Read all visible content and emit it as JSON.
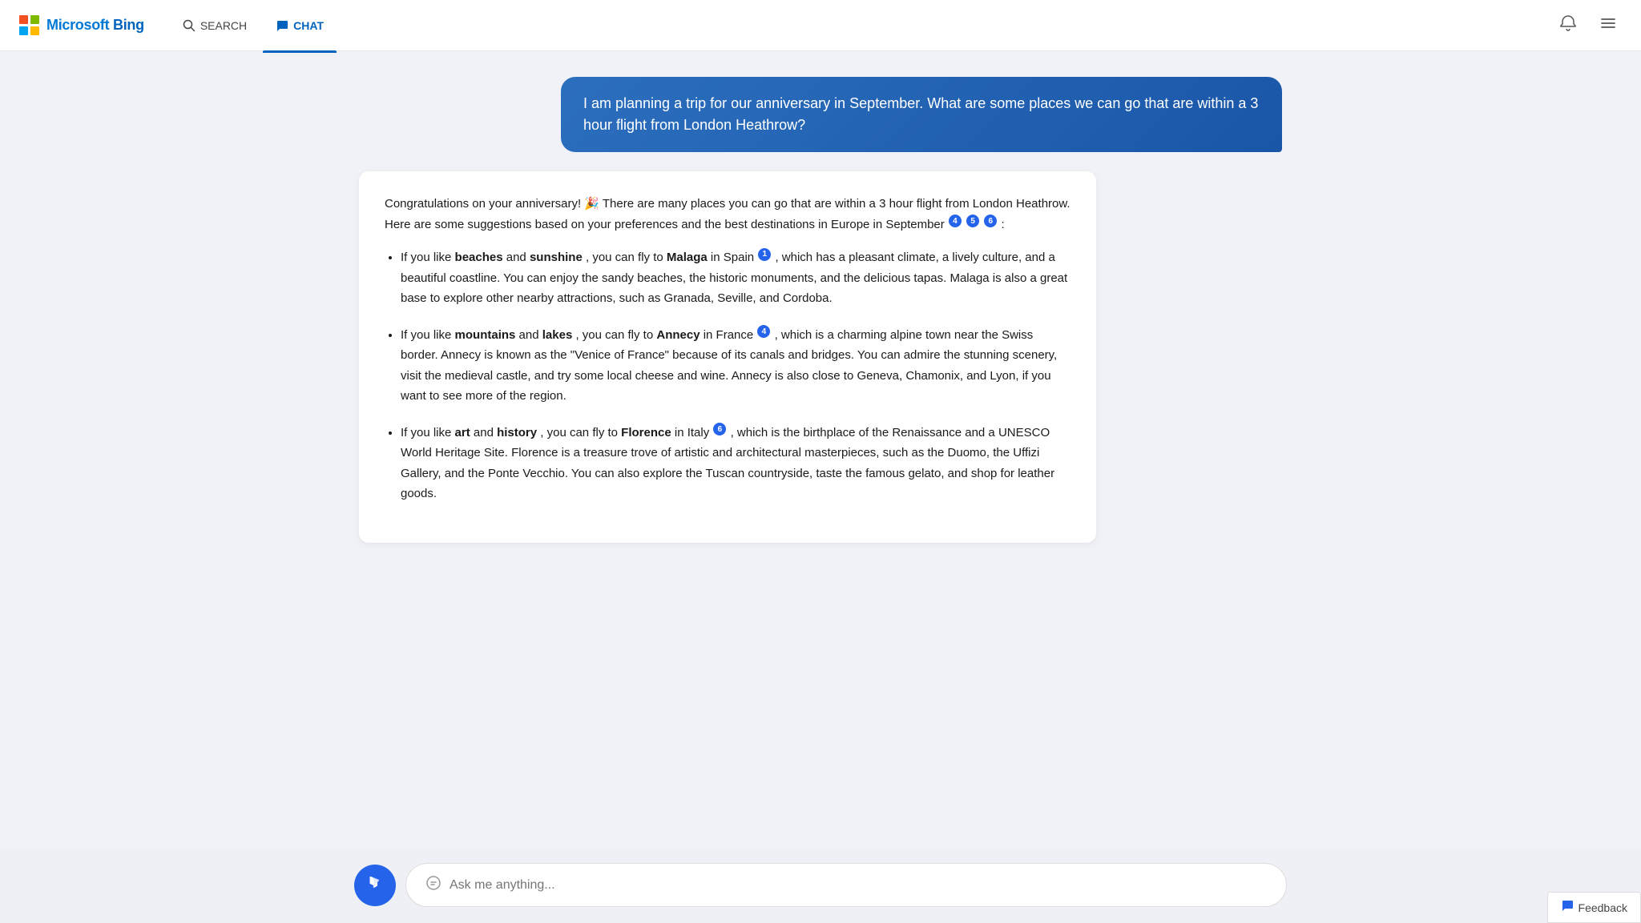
{
  "header": {
    "logo_text_part1": "Microsoft ",
    "logo_text_part2": "Bing",
    "nav": [
      {
        "id": "search",
        "label": "SEARCH",
        "icon": "🔍",
        "active": false
      },
      {
        "id": "chat",
        "label": "CHAT",
        "icon": "💬",
        "active": true
      }
    ]
  },
  "user_message": {
    "text": "I am planning a trip for our anniversary in September. What are some places we can go that are within a 3 hour flight from London Heathrow?"
  },
  "ai_response": {
    "intro": "Congratulations on your anniversary! 🎉 There are many places you can go that are within a 3 hour flight from London Heathrow. Here are some suggestions based on your preferences and the best destinations in Europe in September",
    "intro_cites": [
      "4",
      "5",
      "6"
    ],
    "items": [
      {
        "prefix": "If you like ",
        "bold1": "beaches",
        "mid1": " and ",
        "bold2": "sunshine",
        "mid2": ", you can fly to ",
        "dest": "Malaga",
        "dest_suffix": " in Spain",
        "cite": "1",
        "rest": ", which has a pleasant climate, a lively culture, and a beautiful coastline. You can enjoy the sandy beaches, the historic monuments, and the delicious tapas. Malaga is also a great base to explore other nearby attractions, such as Granada, Seville, and Cordoba."
      },
      {
        "prefix": "If you like ",
        "bold1": "mountains",
        "mid1": " and ",
        "bold2": "lakes",
        "mid2": ", you can fly to ",
        "dest": "Annecy",
        "dest_suffix": " in France",
        "cite": "4",
        "rest": ", which is a charming alpine town near the Swiss border. Annecy is known as the \"Venice of France\" because of its canals and bridges. You can admire the stunning scenery, visit the medieval castle, and try some local cheese and wine. Annecy is also close to Geneva, Chamonix, and Lyon, if you want to see more of the region."
      },
      {
        "prefix": "If you like ",
        "bold1": "art",
        "mid1": " and ",
        "bold2": "history",
        "mid2": ", you can fly to ",
        "dest": "Florence",
        "dest_suffix": " in Italy",
        "cite": "6",
        "rest": ", which is the birthplace of the Renaissance and a UNESCO World Heritage Site. Florence is a treasure trove of artistic and architectural masterpieces, such as the Duomo, the Uffizi Gallery, and the Ponte Vecchio. You can also explore the Tuscan countryside, taste the famous gelato, and shop for leather goods."
      }
    ]
  },
  "input": {
    "placeholder": "Ask me anything..."
  },
  "feedback": {
    "label": "Feedback"
  }
}
